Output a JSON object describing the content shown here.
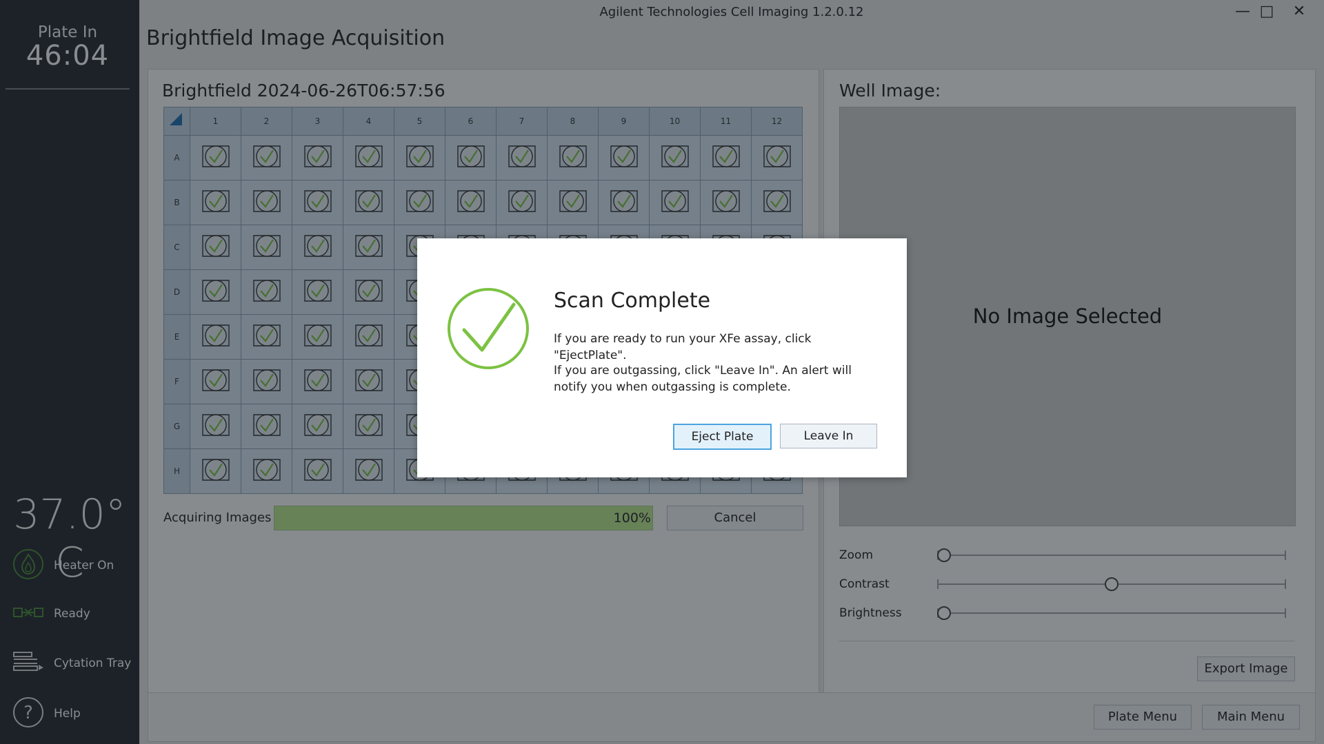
{
  "app": {
    "title": "Agilent Technologies Cell Imaging 1.2.0.12",
    "page_title": "Brightfield Image Acquisition",
    "controls": {
      "minimize": "—",
      "maximize": "□",
      "close": "✕"
    }
  },
  "sidebar": {
    "plate_label": "Plate In",
    "timer": "46:04",
    "temperature": "37.0° C",
    "items": [
      {
        "label": "Heater On",
        "icon": "heater-flame-icon"
      },
      {
        "label": "Ready",
        "icon": "ready-connector-icon"
      },
      {
        "label": "Cytation Tray",
        "icon": "tray-icon"
      },
      {
        "label": "Help",
        "icon": "help-icon"
      }
    ]
  },
  "acquisition": {
    "title": "Brightfield 2024-06-26T06:57:56",
    "columns": [
      "1",
      "2",
      "3",
      "4",
      "5",
      "6",
      "7",
      "8",
      "9",
      "10",
      "11",
      "12"
    ],
    "rows": [
      "A",
      "B",
      "C",
      "D",
      "E",
      "F",
      "G",
      "H"
    ],
    "well_status": "complete",
    "progress_label": "Acquiring Images",
    "progress_percent": 100,
    "progress_text": "100%",
    "cancel_label": "Cancel"
  },
  "well_image": {
    "title": "Well Image:",
    "placeholder": "No Image Selected",
    "sliders": [
      {
        "label": "Zoom",
        "value": 0.0
      },
      {
        "label": "Contrast",
        "value": 0.5
      },
      {
        "label": "Brightness",
        "value": 0.0
      }
    ],
    "export_label": "Export Image"
  },
  "footer": {
    "plate_menu": "Plate Menu",
    "main_menu": "Main Menu"
  },
  "dialog": {
    "title": "Scan Complete",
    "message1": "If you are ready to run your XFe assay, click \"EjectPlate\".",
    "message2": "If you are outgassing, click \"Leave In\". An alert will notify you when outgassing is complete.",
    "eject_label": "Eject Plate",
    "leave_label": "Leave In",
    "icon": "success-check-icon"
  },
  "colors": {
    "accent_green": "#7cc242",
    "sidebar_bg": "#24292f",
    "plate_blue": "#d6e5f2",
    "progress_green": "#bde98f",
    "button_highlight": "#e3f1fb"
  }
}
